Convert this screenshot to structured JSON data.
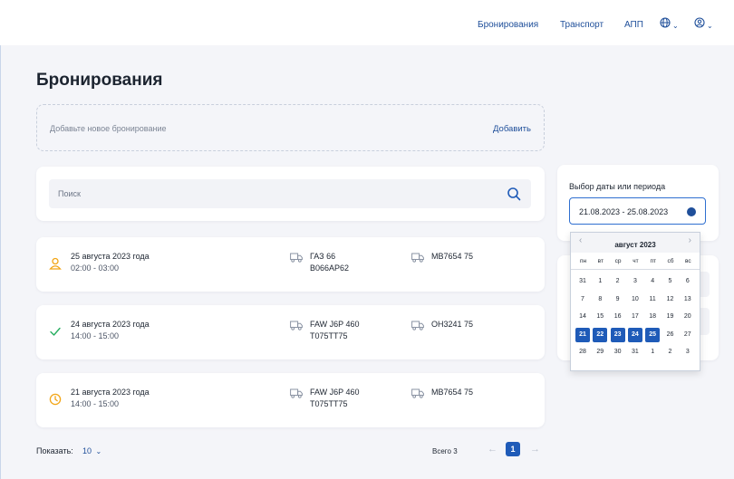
{
  "nav": {
    "links": [
      "Бронирования",
      "Транспорт",
      "АПП"
    ],
    "globe_icon": "globe-icon",
    "user_icon": "user-circle-icon",
    "chevron": "⌄"
  },
  "page": {
    "title": "Бронирования",
    "add_placeholder": "Добавьте новое бронирование",
    "add_button": "Добавить",
    "search_placeholder": "Поиск"
  },
  "bookings": [
    {
      "status": "user-icon",
      "status_color": "#f2a516",
      "date": "25 августа 2023 года",
      "time": "02:00 - 03:00",
      "vehicle_model": "ГАЗ 66",
      "vehicle_plate": "В066АР62",
      "trailer": "МВ7654 75"
    },
    {
      "status": "check-icon",
      "status_color": "#27ae60",
      "date": "24 августа 2023 года",
      "time": "14:00 - 15:00",
      "vehicle_model": "FAW J6P 460",
      "vehicle_plate": "Т075ТТ75",
      "trailer": "ОН3241 75"
    },
    {
      "status": "clock-icon",
      "status_color": "#f2a516",
      "date": "21 августа 2023 года",
      "time": "14:00 - 15:00",
      "vehicle_model": "FAW J6P 460",
      "vehicle_plate": "Т075ТТ75",
      "trailer": "МВ7654 75"
    }
  ],
  "pagination": {
    "show_label": "Показать:",
    "show_value": "10",
    "total": "Всего 3",
    "current_page": "1",
    "prev": "←",
    "next": "→"
  },
  "date_filter": {
    "label": "Выбор даты или периода",
    "value": "21.08.2023 - 25.08.2023"
  },
  "calendar": {
    "month": "август 2023",
    "prev": "‹",
    "next": "›",
    "weekdays": [
      "пн",
      "вт",
      "ср",
      "чт",
      "пт",
      "сб",
      "вс"
    ],
    "weeks": [
      [
        "31",
        "1",
        "2",
        "3",
        "4",
        "5",
        "6"
      ],
      [
        "7",
        "8",
        "9",
        "10",
        "11",
        "12",
        "13"
      ],
      [
        "14",
        "15",
        "16",
        "17",
        "18",
        "19",
        "20"
      ],
      [
        "21",
        "22",
        "23",
        "24",
        "25",
        "26",
        "27"
      ],
      [
        "28",
        "29",
        "30",
        "31",
        "1",
        "2",
        "3"
      ]
    ],
    "selected": [
      "21",
      "22",
      "23",
      "24",
      "25"
    ],
    "selected_week": 3,
    "accent": "#1f5bb8"
  }
}
